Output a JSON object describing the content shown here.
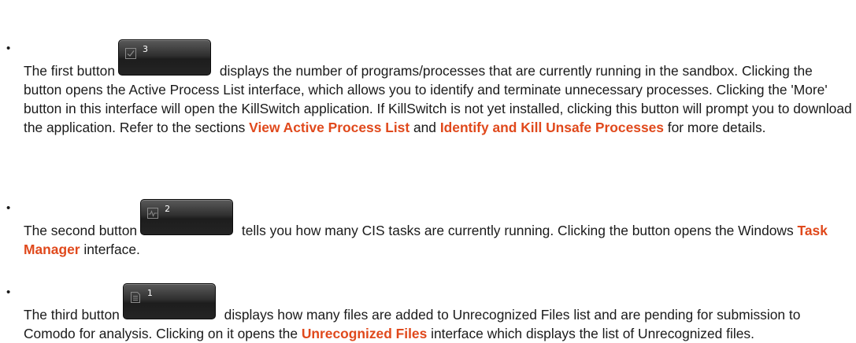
{
  "items": [
    {
      "before": "The first button",
      "button_count": "3",
      "button_icon": "checkbox-icon",
      "text1": " displays the number of programs/processes that are currently running in the sandbox. Clicking the button opens the Active Process List interface, which allows you to identify and terminate unnecessary processes. Clicking the 'More' button in this interface will open the KillSwitch application. If KillSwitch is not yet installed, clicking this button will prompt you to download the application. Refer to the sections ",
      "link1": "View Active Process List",
      "text2": " and ",
      "link2": "Identify and Kill Unsafe Processes",
      "text3": " for more details."
    },
    {
      "before": "The second button",
      "button_count": "2",
      "button_icon": "activity-graph-icon",
      "text1": " tells you how many CIS tasks are currently running. Clicking the button opens the Windows ",
      "link1": "Task Manager",
      "text2": " interface."
    },
    {
      "before": "The third button",
      "button_count": "1",
      "button_icon": "document-list-icon",
      "text1": " displays how many files are added to Unrecognized Files list and are pending for submission to Comodo for analysis. Clicking on it opens the ",
      "link1": "Unrecognized Files",
      "text2": " interface which displays the list of Unrecognized files."
    }
  ],
  "colors": {
    "link": "#e0491c",
    "button_bg": "#2a2a2a",
    "text": "#1a1a1a"
  }
}
